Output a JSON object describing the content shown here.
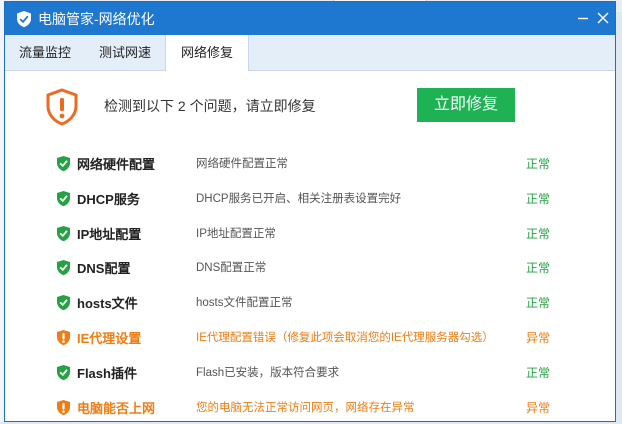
{
  "window": {
    "title": "电脑管家-网络优化",
    "logo_icon": "shield-logo-icon",
    "controls": [
      "minimize-icon",
      "close-icon"
    ]
  },
  "tabs": [
    {
      "label": "流量监控",
      "active": false
    },
    {
      "label": "测试网速",
      "active": false
    },
    {
      "label": "网络修复",
      "active": true
    }
  ],
  "alert": {
    "icon": "warning-shield-icon",
    "text": "检测到以下 2 个问题，请立即修复",
    "button_label": "立即修复"
  },
  "colors": {
    "title_bar": "#1e78d0",
    "ok_green": "#25a244",
    "warn_orange": "#ef7d13",
    "button_green": "#1fb255"
  },
  "items": [
    {
      "name": "网络硬件配置",
      "description": "网络硬件配置正常",
      "status": "正常",
      "state": "ok"
    },
    {
      "name": "DHCP服务",
      "description": "DHCP服务已开启、相关注册表设置完好",
      "status": "正常",
      "state": "ok"
    },
    {
      "name": "IP地址配置",
      "description": "IP地址配置正常",
      "status": "正常",
      "state": "ok"
    },
    {
      "name": "DNS配置",
      "description": "DNS配置正常",
      "status": "正常",
      "state": "ok"
    },
    {
      "name": "hosts文件",
      "description": "hosts文件配置正常",
      "status": "正常",
      "state": "ok"
    },
    {
      "name": "IE代理设置",
      "description": "IE代理配置错误（修复此项会取消您的IE代理服务器勾选）",
      "status": "异常",
      "state": "warn"
    },
    {
      "name": "Flash插件",
      "description": "Flash已安装，版本符合要求",
      "status": "正常",
      "state": "ok"
    },
    {
      "name": "电脑能否上网",
      "description": "您的电脑无法正常访问网页，网络存在异常",
      "status": "异常",
      "state": "warn"
    }
  ]
}
